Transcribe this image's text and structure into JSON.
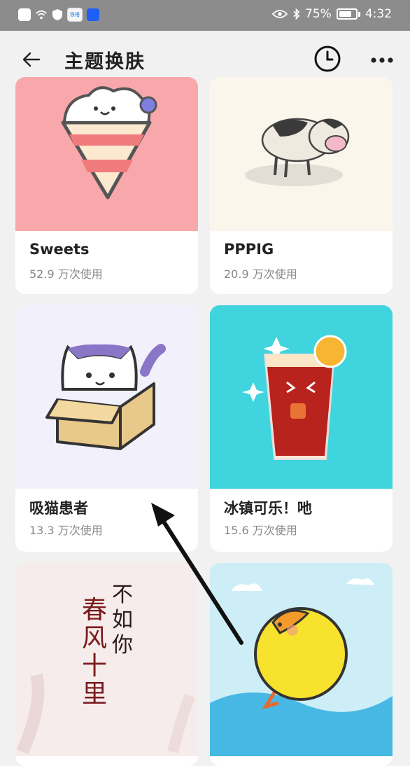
{
  "status_bar": {
    "battery": "75%",
    "time": "4:32",
    "app_badge": "铁塔"
  },
  "header": {
    "title": "主题换肤"
  },
  "themes": [
    {
      "name": "Sweets",
      "usage": "52.9 万次使用"
    },
    {
      "name": "PPPIG",
      "usage": "20.9 万次使用"
    },
    {
      "name": "吸猫患者",
      "usage": "13.3 万次使用"
    },
    {
      "name": "冰镇可乐！吔",
      "usage": "15.6 万次使用"
    },
    {
      "name": "",
      "usage": ""
    },
    {
      "name": "",
      "usage": ""
    }
  ],
  "artwork": {
    "calligraphy_left": "春风十里",
    "calligraphy_right": "不如你"
  },
  "colors": {
    "sweets_bg": "#f8a8ab",
    "cola_bg": "#3fd4de",
    "sky_bg": "#cdeef7"
  }
}
